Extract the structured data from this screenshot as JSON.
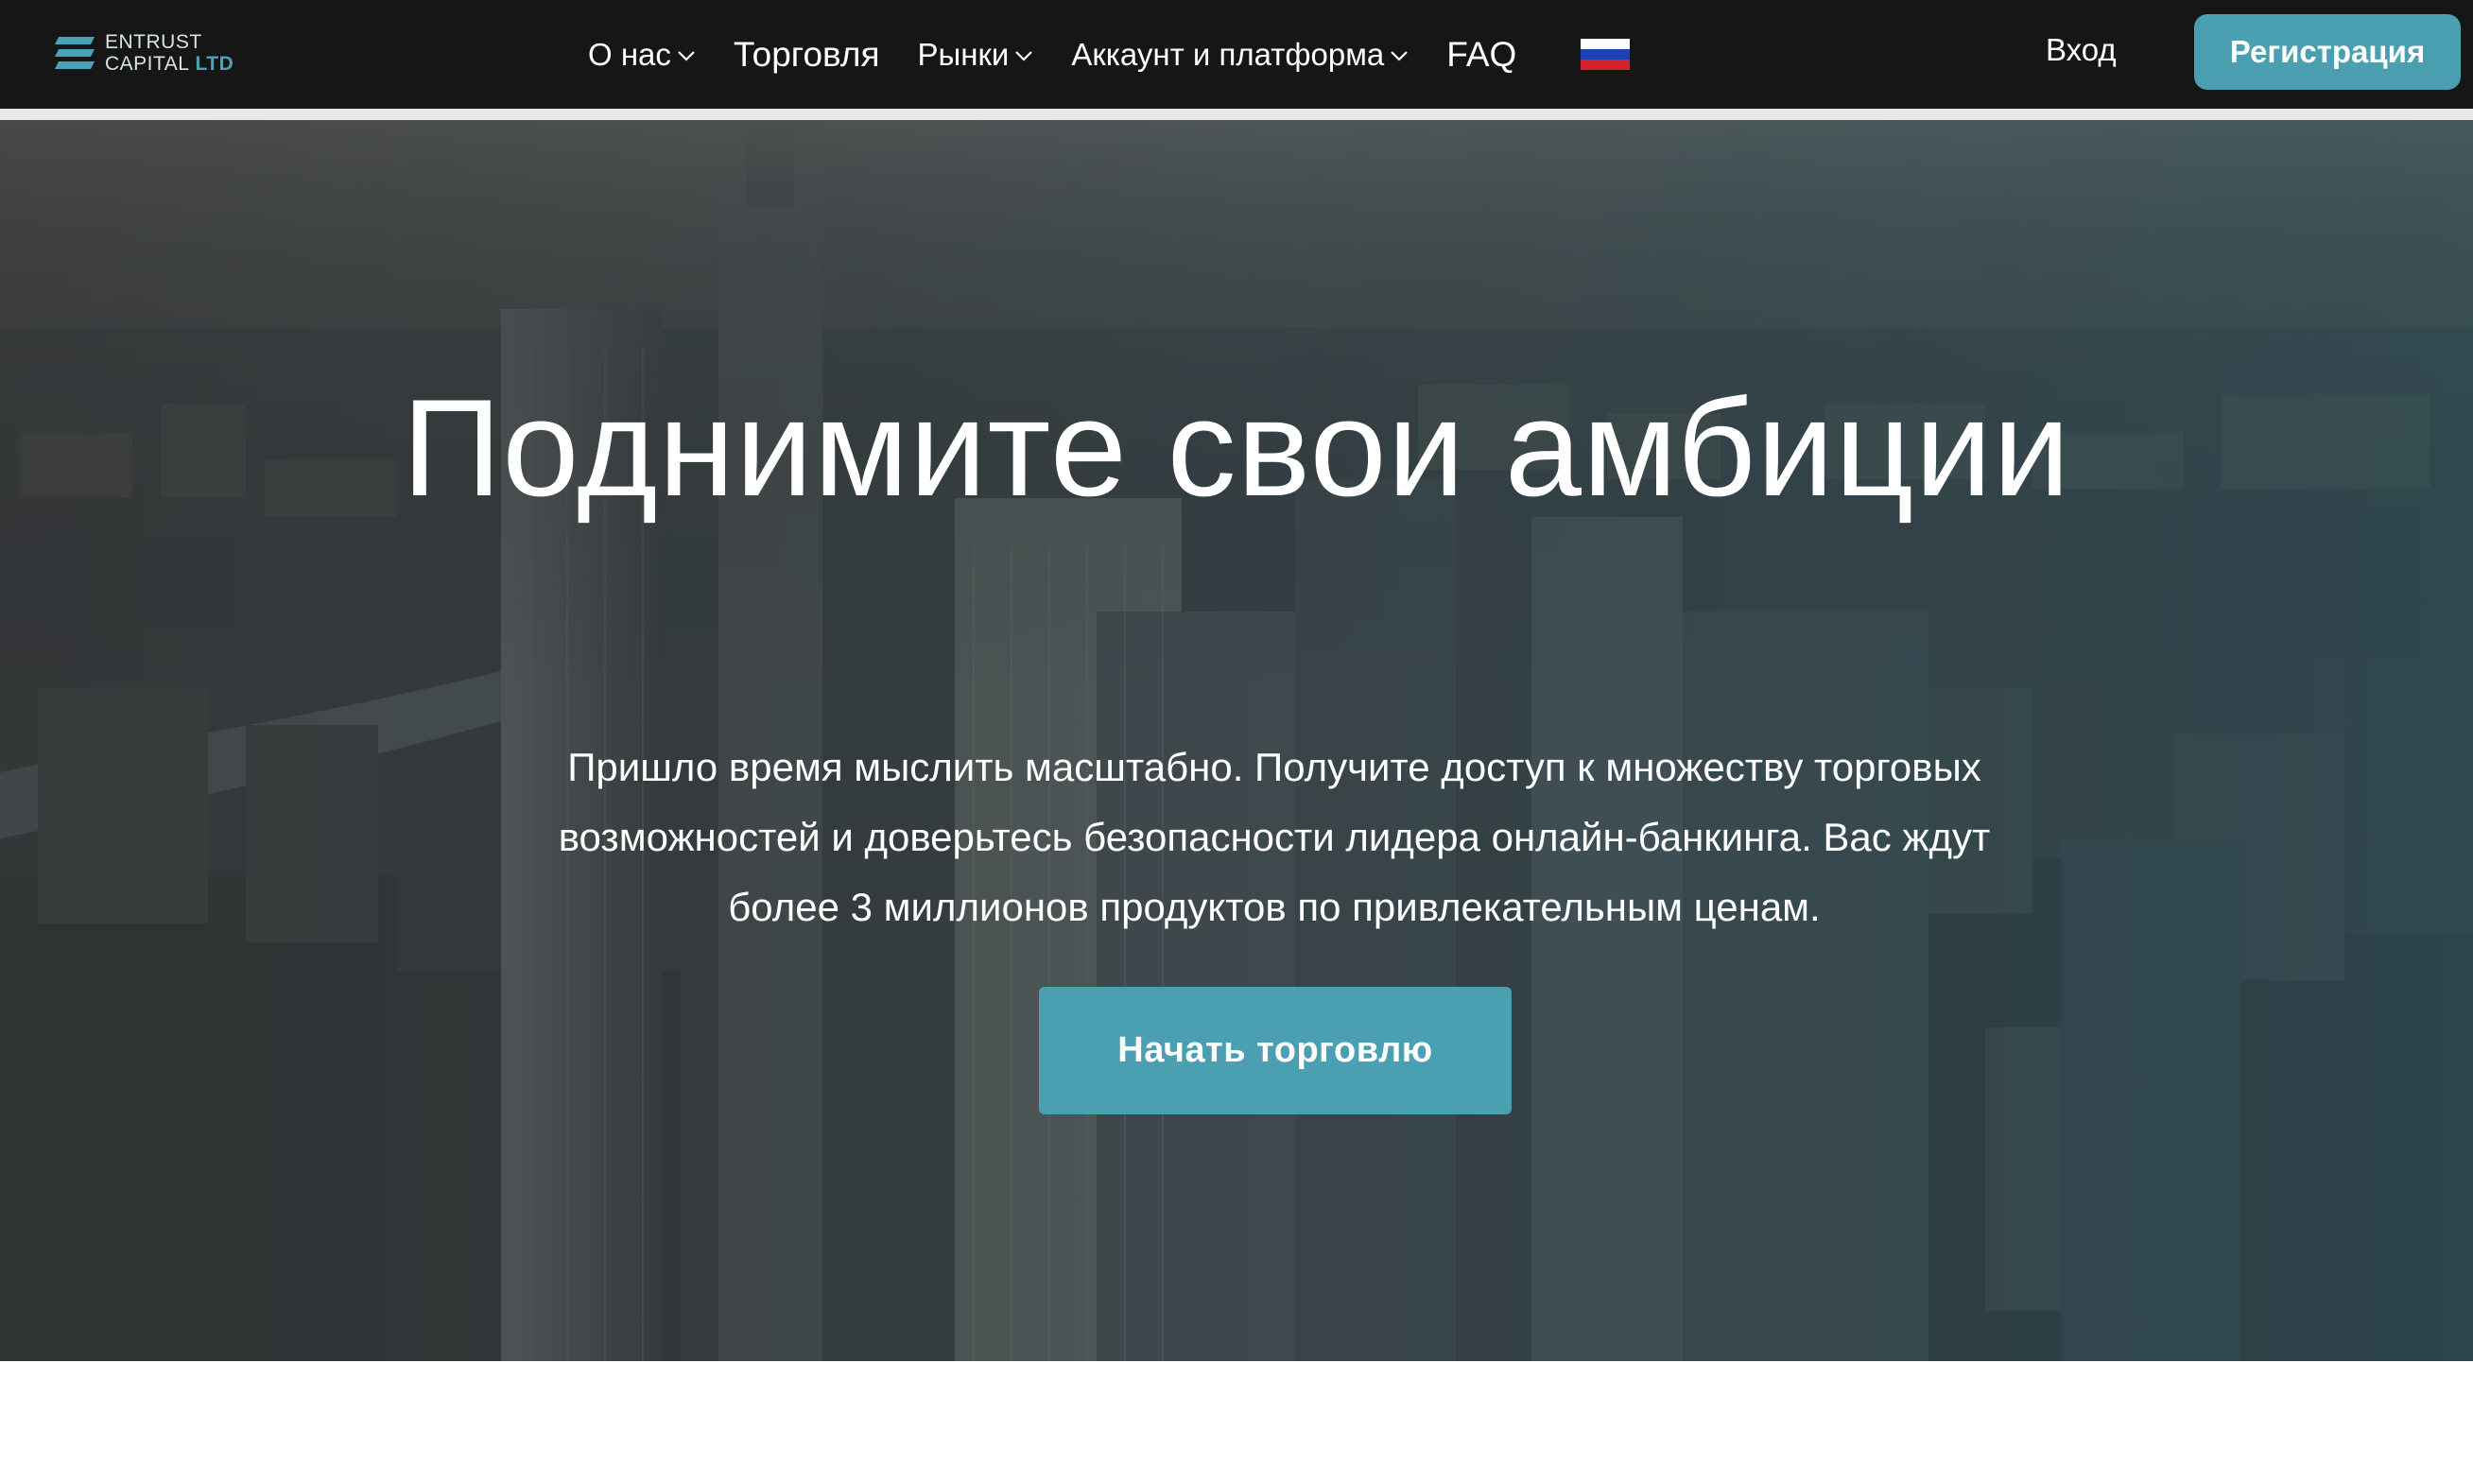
{
  "brand": {
    "line1": "ENTRUST",
    "line2": "CAPITAL",
    "suffix": "LTD",
    "accent_color": "#4aa3b5"
  },
  "nav": {
    "items": [
      {
        "label": "О нас",
        "has_dropdown": true
      },
      {
        "label": "Торговля",
        "has_dropdown": false
      },
      {
        "label": "Рынки",
        "has_dropdown": true
      },
      {
        "label": "Аккаунт и платформа",
        "has_dropdown": true
      },
      {
        "label": "FAQ",
        "has_dropdown": false
      }
    ],
    "language_flag": "russia-flag-icon"
  },
  "header": {
    "login_label": "Вход",
    "register_label": "Регистрация",
    "background": "#161616",
    "button_color": "#4a9fb1"
  },
  "hero": {
    "title": "Поднимите свои амбиции",
    "description": "Пришло время мыслить масштабно. Получите доступ к множеству торговых возможностей и доверьтесь безопасности лидера онлайн-банкинга. Вас ждут более 3 миллионов продуктов по привлекательным ценам.",
    "cta_label": "Начать торговлю"
  }
}
